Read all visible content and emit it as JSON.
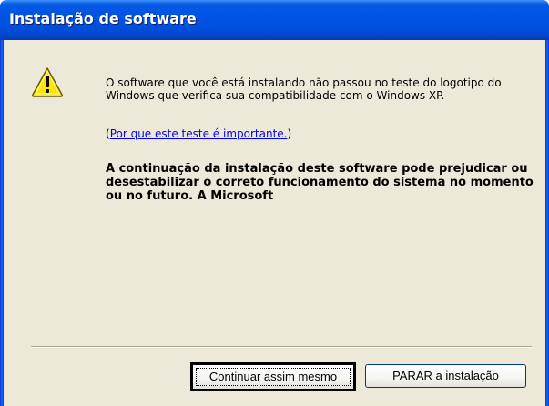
{
  "window": {
    "title": "Instalação de software"
  },
  "message": {
    "body": "O software que você está instalando não passou no teste do logotipo do Windows que verifica sua compatibilidade com o Windows XP.",
    "link_open": "(",
    "link_text": "Por que este teste é importante.",
    "link_close": ")",
    "warning": "A continuação da instalação deste software pode prejudicar ou desestabilizar o correto funcionamento do sistema no momento ou no futuro. A Microsoft"
  },
  "icons": {
    "warning": "warning-icon"
  },
  "buttons": {
    "continue": "Continuar assim mesmo",
    "stop": "PARAR a instalação"
  },
  "colors": {
    "titlebar": "#0055e5",
    "client_bg": "#ece9d8",
    "link": "#0000ff",
    "icon_fill": "#ffe600"
  }
}
